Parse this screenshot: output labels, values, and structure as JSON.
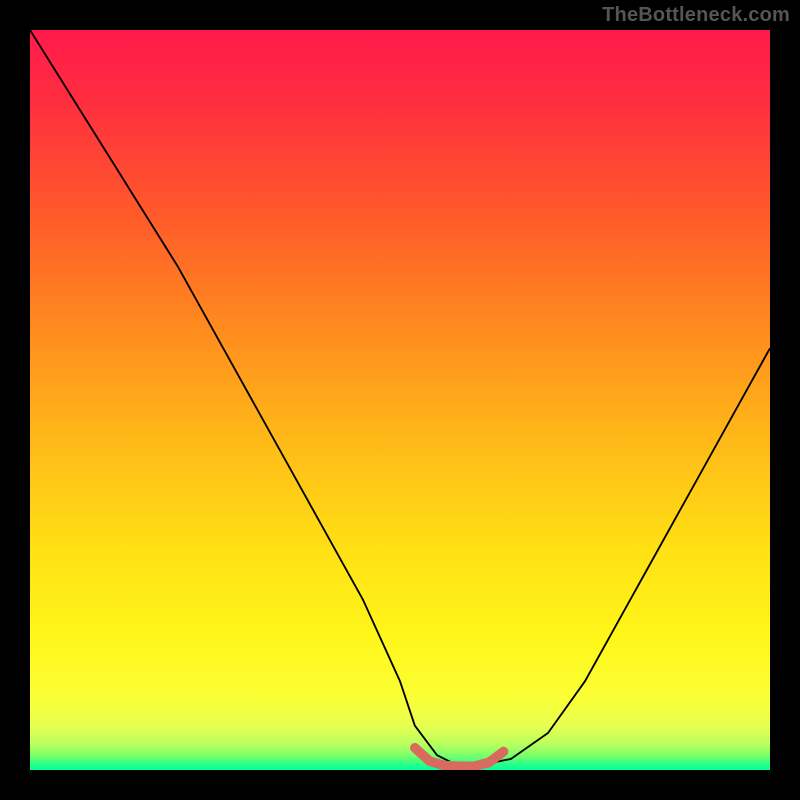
{
  "watermark": "TheBottleneck.com",
  "colors": {
    "page_bg": "#000000",
    "curve": "#000000",
    "highlight": "#d96a5e",
    "gradient_top": "#ff1a4b",
    "gradient_mid": "#ffe014",
    "gradient_bottom": "#00ffa2"
  },
  "chart_data": {
    "type": "line",
    "title": "",
    "xlabel": "",
    "ylabel": "",
    "xlim": [
      0,
      100
    ],
    "ylim": [
      0,
      100
    ],
    "grid": false,
    "legend": false,
    "series": [
      {
        "name": "bottleneck-curve",
        "x": [
          0,
          5,
          10,
          15,
          20,
          25,
          30,
          35,
          40,
          45,
          50,
          52,
          55,
          58,
          60,
          65,
          70,
          75,
          80,
          85,
          90,
          95,
          100
        ],
        "y": [
          100,
          92,
          84,
          76,
          68,
          59,
          50,
          41,
          32,
          23,
          12,
          6,
          2,
          0.5,
          0.5,
          1.5,
          5,
          12,
          21,
          30,
          39,
          48,
          57
        ]
      },
      {
        "name": "optimal-band",
        "x": [
          52,
          54,
          56,
          58,
          60,
          62,
          64
        ],
        "y": [
          3,
          1.2,
          0.6,
          0.5,
          0.5,
          1.0,
          2.5
        ]
      }
    ],
    "annotations": []
  }
}
